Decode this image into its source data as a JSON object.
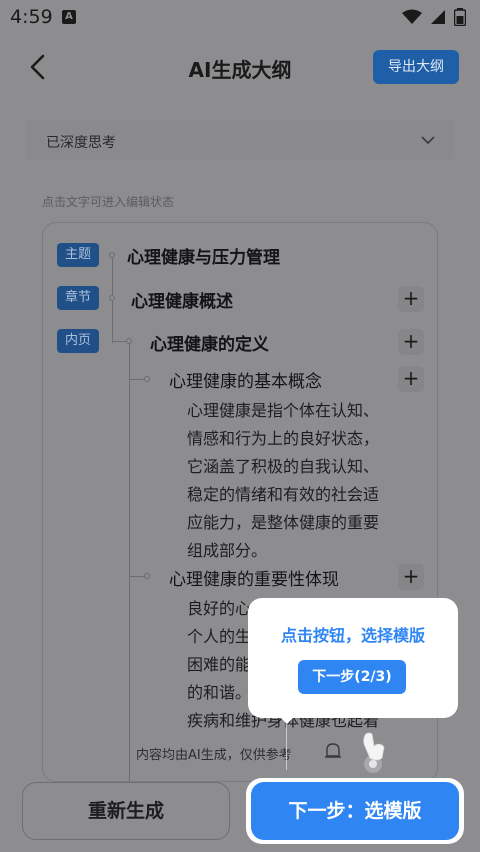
{
  "status_bar": {
    "time": "4:59",
    "app_badge": "A"
  },
  "header": {
    "title": "AI生成大纲",
    "export_label": "导出大纲"
  },
  "think_row": {
    "label": "已深度思考"
  },
  "hint": "点击文字可进入编辑状态",
  "outline": {
    "badges": {
      "topic": "主题",
      "chapter": "章节",
      "page": "内页"
    },
    "topic": "心理健康与压力管理",
    "chapter": "心理健康概述",
    "page": "心理健康的定义",
    "points": [
      {
        "title": "心理健康的基本概念",
        "lines": [
          "心理健康是指个体在认知、",
          "情感和行为上的良好状态，",
          "它涵盖了积极的自我认知、",
          "稳定的情绪和有效的社会适",
          "应能力，是整体健康的重要",
          "组成部分。"
        ]
      },
      {
        "title": "心理健康的重要性体现",
        "lines": [
          "良好的心",
          "个人的生",
          "困难的能",
          "的和谐。",
          "疾病和维护身体健康也起着"
        ]
      }
    ],
    "plus_symbol": "+"
  },
  "disclaimer": "内容均由AI生成，仅供参考",
  "buttons": {
    "regenerate": "重新生成",
    "next": "下一步：选模版"
  },
  "tooltip": {
    "message": "点击按钮，选择模版",
    "step_label": "下一步(2/3)"
  },
  "colors": {
    "accent": "#2f86f2",
    "badge": "#214f87",
    "overlay": "#8d8d8f"
  }
}
